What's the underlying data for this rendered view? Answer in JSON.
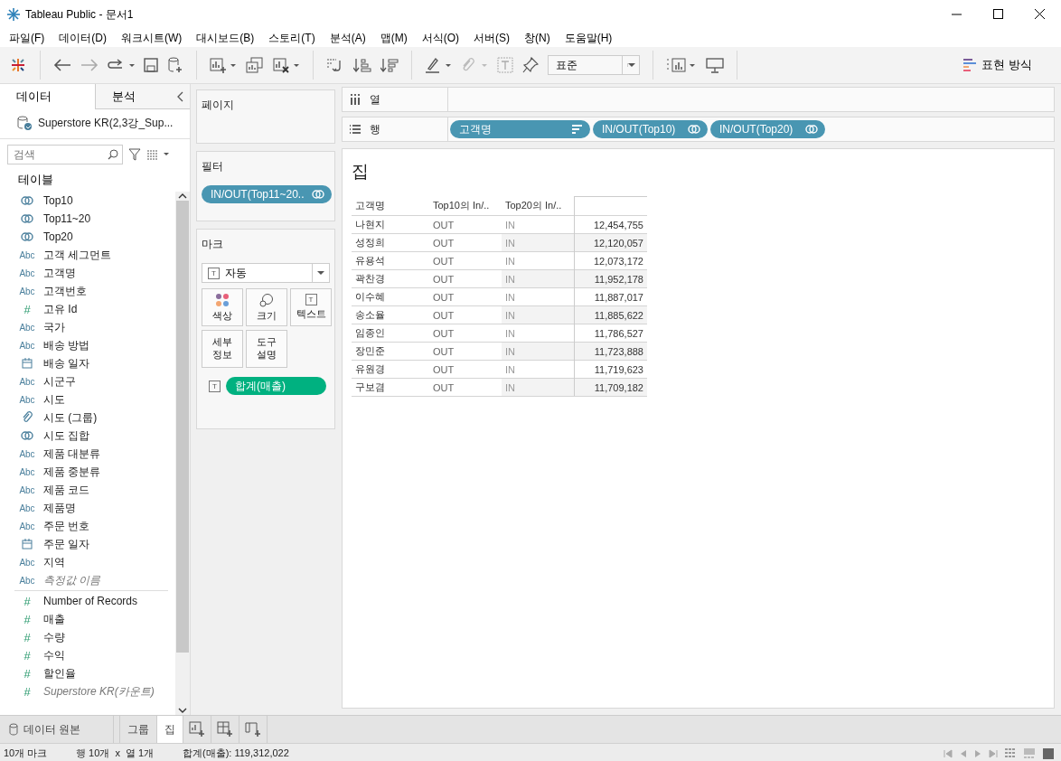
{
  "window": {
    "title": "Tableau Public - 문서1"
  },
  "menu": [
    "파일(F)",
    "데이터(D)",
    "워크시트(W)",
    "대시보드(B)",
    "스토리(T)",
    "분석(A)",
    "맵(M)",
    "서식(O)",
    "서버(S)",
    "창(N)",
    "도움말(H)"
  ],
  "toolbar": {
    "fit": "표준",
    "show_me": "표현 방식"
  },
  "data_pane": {
    "tabs": [
      {
        "label": "데이터",
        "selected": true
      },
      {
        "label": "분석",
        "selected": false
      }
    ],
    "source": "Superstore KR(2,3강_Sup...",
    "search": {
      "placeholder": "검색"
    },
    "section": "테이블",
    "fields": [
      {
        "kind": "set",
        "label": "Top10",
        "italic": false
      },
      {
        "kind": "set",
        "label": "Top11~20",
        "italic": false
      },
      {
        "kind": "set",
        "label": "Top20",
        "italic": false
      },
      {
        "kind": "string",
        "icon": "Abc",
        "label": "고객 세그먼트",
        "italic": false
      },
      {
        "kind": "string",
        "icon": "Abc",
        "label": "고객명",
        "italic": false
      },
      {
        "kind": "string",
        "icon": "Abc",
        "label": "고객번호",
        "italic": false
      },
      {
        "kind": "number",
        "icon": "#",
        "label": "고유 Id",
        "italic": false
      },
      {
        "kind": "string",
        "icon": "Abc",
        "label": "국가",
        "italic": false
      },
      {
        "kind": "string",
        "icon": "Abc",
        "label": "배송 방법",
        "italic": false
      },
      {
        "kind": "date",
        "label": "배송 일자",
        "italic": false
      },
      {
        "kind": "string",
        "icon": "Abc",
        "label": "시군구",
        "italic": false
      },
      {
        "kind": "string",
        "icon": "Abc",
        "label": "시도",
        "italic": false
      },
      {
        "kind": "group",
        "label": "시도 (그룹)",
        "italic": false
      },
      {
        "kind": "set",
        "label": "시도 집합",
        "italic": false
      },
      {
        "kind": "string",
        "icon": "Abc",
        "label": "제품 대분류",
        "italic": false
      },
      {
        "kind": "string",
        "icon": "Abc",
        "label": "제품 중분류",
        "italic": false
      },
      {
        "kind": "string",
        "icon": "Abc",
        "label": "제품 코드",
        "italic": false
      },
      {
        "kind": "string",
        "icon": "Abc",
        "label": "제품명",
        "italic": false
      },
      {
        "kind": "string",
        "icon": "Abc",
        "label": "주문 번호",
        "italic": false
      },
      {
        "kind": "date",
        "label": "주문 일자",
        "italic": false
      },
      {
        "kind": "string",
        "icon": "Abc",
        "label": "지역",
        "italic": false
      },
      {
        "kind": "string",
        "icon": "Abc",
        "label": "측정값 이름",
        "italic": true
      }
    ],
    "measures": [
      {
        "kind": "measure",
        "icon": "#",
        "label": "Number of Records",
        "italic": false
      },
      {
        "kind": "measure",
        "icon": "#",
        "label": "매출",
        "italic": false
      },
      {
        "kind": "measure",
        "icon": "#",
        "label": "수량",
        "italic": false
      },
      {
        "kind": "measure",
        "icon": "#",
        "label": "수익",
        "italic": false
      },
      {
        "kind": "measure",
        "icon": "#",
        "label": "할인율",
        "italic": false
      },
      {
        "kind": "measure",
        "icon": "#",
        "label": "Superstore KR(카운트)",
        "italic": true
      }
    ]
  },
  "pages_card": {
    "title": "페이지"
  },
  "filters_card": {
    "title": "필터",
    "pills": [
      {
        "label": "IN/OUT(Top11~20..",
        "kind": "set"
      }
    ]
  },
  "marks_card": {
    "title": "마크",
    "mark_type": {
      "icon": "T",
      "label": "자동"
    },
    "buttons": [
      {
        "kind": "color",
        "label": "색상"
      },
      {
        "kind": "size",
        "label": "크기"
      },
      {
        "kind": "text",
        "icon": "T",
        "label": "텍스트"
      },
      {
        "kind": "detail",
        "label": "세부 정보"
      },
      {
        "kind": "tooltip",
        "label": "도구 설명"
      }
    ],
    "pills": [
      {
        "icon": "T",
        "label": "합계(매출)"
      }
    ]
  },
  "columns_shelf": {
    "label": "열"
  },
  "rows_shelf": {
    "label": "행",
    "pills": [
      {
        "label": "고객명",
        "kind": "sorted"
      },
      {
        "label": "IN/OUT(Top10)",
        "kind": "set"
      },
      {
        "label": "IN/OUT(Top20)",
        "kind": "set"
      }
    ]
  },
  "sheet": {
    "title": "집",
    "columns": [
      "고객명",
      "Top10의 In/..",
      "Top20의 In/.."
    ],
    "rows": [
      [
        "나현지",
        "OUT",
        "IN",
        "12,454,755"
      ],
      [
        "성정희",
        "OUT",
        "IN",
        "12,120,057"
      ],
      [
        "유용석",
        "OUT",
        "IN",
        "12,073,172"
      ],
      [
        "곽찬경",
        "OUT",
        "IN",
        "11,952,178"
      ],
      [
        "이수혜",
        "OUT",
        "IN",
        "11,887,017"
      ],
      [
        "송소율",
        "OUT",
        "IN",
        "11,885,622"
      ],
      [
        "임종인",
        "OUT",
        "IN",
        "11,786,527"
      ],
      [
        "장민준",
        "OUT",
        "IN",
        "11,723,888"
      ],
      [
        "유원경",
        "OUT",
        "IN",
        "11,719,623"
      ],
      [
        "구보겸",
        "OUT",
        "IN",
        "11,709,182"
      ]
    ]
  },
  "bottom_tabs": {
    "data_source": "데이터 원본",
    "sheets": [
      {
        "label": "그룹",
        "selected": false
      },
      {
        "label": "집",
        "selected": true
      }
    ]
  },
  "status_bar": {
    "marks": "10개 마크",
    "rows_cols": "행 10개  x  열 1개",
    "sum": "합계(매출): 119,312,022"
  }
}
